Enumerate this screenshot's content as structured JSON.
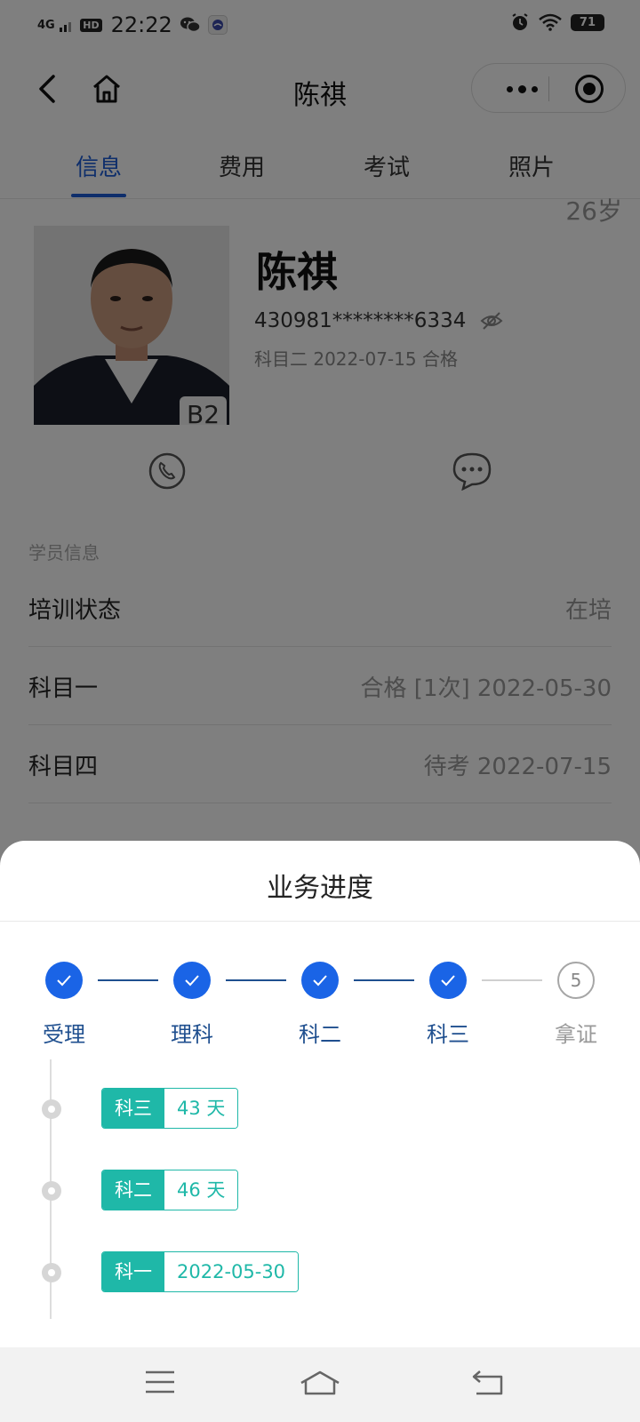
{
  "status_bar": {
    "network": "4G",
    "hd": "HD",
    "time": "22:22",
    "battery": "71"
  },
  "nav": {
    "title": "陈祺"
  },
  "tabs": [
    {
      "label": "信息",
      "active": true
    },
    {
      "label": "费用",
      "active": false
    },
    {
      "label": "考试",
      "active": false
    },
    {
      "label": "照片",
      "active": false
    }
  ],
  "profile": {
    "age": "26岁",
    "license_class": "B2",
    "name": "陈祺",
    "id_number": "430981********6334",
    "exam_status": "科目二 2022-07-15 合格"
  },
  "section": {
    "label": "学员信息"
  },
  "info_rows": [
    {
      "label": "培训状态",
      "value": "在培"
    },
    {
      "label": "科目一",
      "value": "合格 [1次] 2022-05-30"
    },
    {
      "label": "科目四",
      "value": "待考 2022-07-15"
    }
  ],
  "sheet": {
    "title": "业务进度",
    "steps": [
      {
        "label": "受理",
        "done": true
      },
      {
        "label": "理科",
        "done": true
      },
      {
        "label": "科二",
        "done": true
      },
      {
        "label": "科三",
        "done": true
      },
      {
        "label": "拿证",
        "done": false,
        "number": "5"
      }
    ],
    "timeline": [
      {
        "key": "科三",
        "value": "43 天"
      },
      {
        "key": "科二",
        "value": "46 天"
      },
      {
        "key": "科一",
        "value": "2022-05-30"
      }
    ]
  },
  "colors": {
    "accent_blue": "#1a64e6",
    "step_text": "#1f4f8f",
    "teal": "#1fb8a8"
  }
}
